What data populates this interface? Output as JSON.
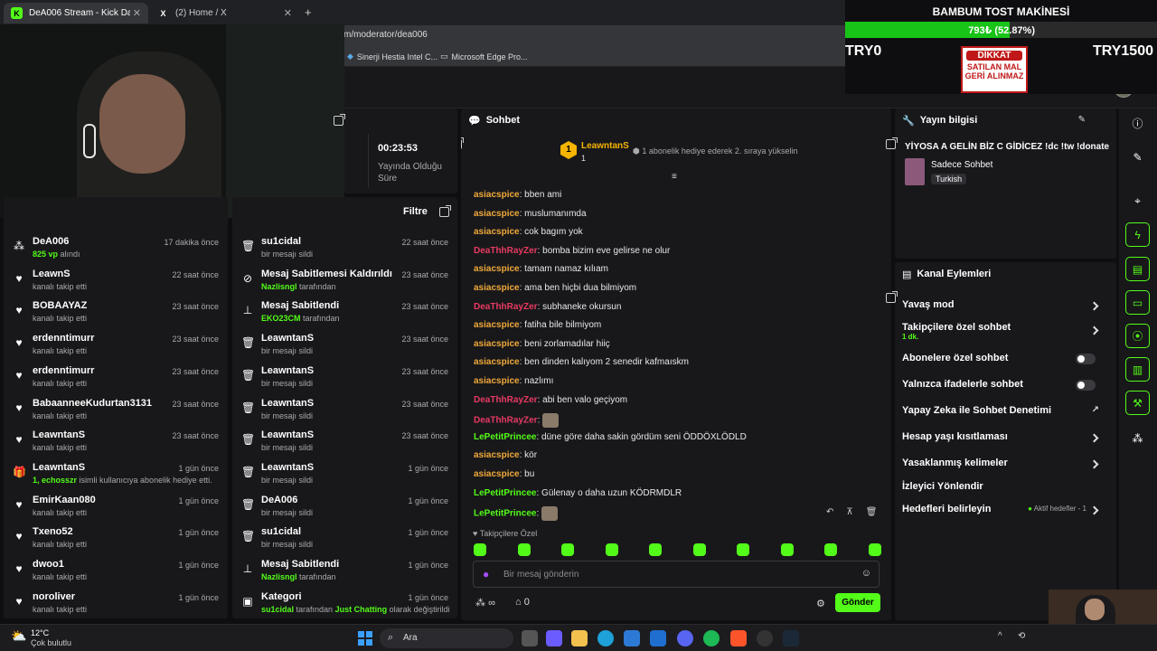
{
  "browser": {
    "tabs": [
      {
        "title": "DeA006 Stream - Kick Dashboard",
        "fav": "K"
      },
      {
        "title": "(2) Home / X",
        "fav": "X"
      }
    ],
    "url": "m/moderator/dea006",
    "bookmarks": [
      "Sinerji Hestia Intel C...",
      "Microsoft Edge Pro..."
    ],
    "new_tab": "+"
  },
  "overlay": {
    "goal_title": "BAMBUM TOST MAKİNESİ",
    "goal_amount": "793₺ (52.87%)",
    "goal_progress": 0.5287,
    "goal_start": "TRY0",
    "goal_end": "TRY1500",
    "sign_top": "DİKKAT",
    "sign_line1": "SATILAN MAL",
    "sign_line2": "GERİ ALINMAZ"
  },
  "stats": {
    "time_value": "00:23:53",
    "time_label_line1": "Yayında Olduğu",
    "time_label_line2": "Süre"
  },
  "activity_left": [
    {
      "icon": "vp-icon",
      "name": "DeA006",
      "sub_hl": "825 vp",
      "sub": " alındı",
      "time": "17 dakika önce"
    },
    {
      "icon": "heart-icon",
      "name": "LeawnS",
      "sub": "kanalı takip etti",
      "time": "22 saat önce"
    },
    {
      "icon": "heart-icon",
      "name": "BOBAAYAZ",
      "sub": "kanalı takip etti",
      "time": "23 saat önce"
    },
    {
      "icon": "heart-icon",
      "name": "erdenntimurr",
      "sub": "kanalı takip etti",
      "time": "23 saat önce"
    },
    {
      "icon": "heart-icon",
      "name": "erdenntimurr",
      "sub": "kanalı takip etti",
      "time": "23 saat önce"
    },
    {
      "icon": "heart-icon",
      "name": "BabaanneeKudurtan3131",
      "sub": "kanalı takip etti",
      "time": "23 saat önce"
    },
    {
      "icon": "heart-icon",
      "name": "LeawntanS",
      "sub": "kanalı takip etti",
      "time": "23 saat önce"
    },
    {
      "icon": "gift-icon",
      "name": "LeawntanS",
      "sub_hl": "1, echosszr",
      "sub": " isimli kullanıcıya abonelik hediye etti.",
      "time": "1 gün önce"
    },
    {
      "icon": "heart-icon",
      "name": "EmirKaan080",
      "sub": "kanalı takip etti",
      "time": "1 gün önce"
    },
    {
      "icon": "heart-icon",
      "name": "Txeno52",
      "sub": "kanalı takip etti",
      "time": "1 gün önce"
    },
    {
      "icon": "heart-icon",
      "name": "dwoo1",
      "sub": "kanalı takip etti",
      "time": "1 gün önce"
    },
    {
      "icon": "heart-icon",
      "name": "noroliver",
      "sub": "kanalı takip etti",
      "time": "1 gün önce"
    }
  ],
  "mod_panel": {
    "filter_label": "Filtre"
  },
  "activity_mid": [
    {
      "icon": "trash-icon",
      "name": "su1cidal",
      "sub": "bir mesajı sildi",
      "time": "22 saat önce"
    },
    {
      "icon": "unpin-icon",
      "name": "Mesaj Sabitlemesi Kaldırıldı",
      "sub_hl": "Nazlisngl",
      "sub": " tarafından",
      "time": "23 saat önce"
    },
    {
      "icon": "pin-icon",
      "name": "Mesaj Sabitlendi",
      "sub_hl": "EKO23CM",
      "sub": " tarafından",
      "time": "23 saat önce"
    },
    {
      "icon": "trash-icon",
      "name": "LeawntanS",
      "sub": "bir mesajı sildi",
      "time": "23 saat önce"
    },
    {
      "icon": "trash-icon",
      "name": "LeawntanS",
      "sub": "bir mesajı sildi",
      "time": "23 saat önce"
    },
    {
      "icon": "trash-icon",
      "name": "LeawntanS",
      "sub": "bir mesajı sildi",
      "time": "23 saat önce"
    },
    {
      "icon": "trash-icon",
      "name": "LeawntanS",
      "sub": "bir mesajı sildi",
      "time": "23 saat önce"
    },
    {
      "icon": "trash-icon",
      "name": "LeawntanS",
      "sub": "bir mesajı sildi",
      "time": "1 gün önce"
    },
    {
      "icon": "trash-icon",
      "name": "DeA006",
      "sub": "bir mesajı sildi",
      "time": "1 gün önce"
    },
    {
      "icon": "trash-icon",
      "name": "su1cidal",
      "sub": "bir mesajı sildi",
      "time": "1 gün önce"
    },
    {
      "icon": "pin-icon",
      "name": "Mesaj Sabitlendi",
      "sub_hl": "Nazlisngl",
      "sub": " tarafından",
      "time": "1 gün önce"
    },
    {
      "icon": "category-icon",
      "name": "Kategori",
      "sub_hl": "su1cidal",
      "sub": " tarafından ",
      "sub_hl2": "Just Chatting",
      "sub2": " olarak değiştirildi",
      "time": "1 gün önce"
    }
  ],
  "chat": {
    "title": "Sohbet",
    "top_user": "LeawntanS",
    "top_rank": "1",
    "top_count": "1",
    "gift_hint": "1 abonelik hediye ederek 2. sıraya yükselin",
    "messages": [
      {
        "user": "asiacspice",
        "color": "#f0a93a",
        "text": "bben ami"
      },
      {
        "user": "asiacspice",
        "color": "#f0a93a",
        "text": "muslumanımda"
      },
      {
        "user": "asiacspice",
        "color": "#f0a93a",
        "text": "cok bagım yok"
      },
      {
        "user": "DeaThhRayZer",
        "color": "#e83a63",
        "text": "bomba bizim eve gelirse ne olur"
      },
      {
        "user": "asiacspice",
        "color": "#f0a93a",
        "text": "tamam namaz kılıam"
      },
      {
        "user": "asiacspice",
        "color": "#f0a93a",
        "text": "ama ben hiçbi dua bilmiyom"
      },
      {
        "user": "DeaThhRayZer",
        "color": "#e83a63",
        "text": "subhaneke okursun"
      },
      {
        "user": "asiacspice",
        "color": "#f0a93a",
        "text": "fatiha bile bilmiyom"
      },
      {
        "user": "asiacspice",
        "color": "#f0a93a",
        "text": "beni zorlamadılar hiiç"
      },
      {
        "user": "asiacspice",
        "color": "#f0a93a",
        "text": "ben dinden kalıyom 2 senedir kafmaıskm"
      },
      {
        "user": "asiacspice",
        "color": "#f0a93a",
        "text": "nazlımı"
      },
      {
        "user": "DeaThhRayZer",
        "color": "#e83a63",
        "text": "abi ben valo geçiyom"
      },
      {
        "user": "DeaThhRayZer",
        "color": "#e83a63",
        "text": "",
        "emote": true
      },
      {
        "user": "LePetitPrincee",
        "color": "#53fc18",
        "text": "düne göre daha sakin gördüm seni ÖDDÖXLÖDLD"
      },
      {
        "user": "asiacspice",
        "color": "#f0a93a",
        "text": "kör"
      },
      {
        "user": "asiacspice",
        "color": "#f0a93a",
        "text": "bu"
      },
      {
        "user": "LePetitPrincee",
        "color": "#53fc18",
        "text": "Gülenay o daha uzun KÖDRMDLR"
      },
      {
        "user": "LePetitPrincee",
        "color": "#53fc18",
        "text": "",
        "emote": true
      }
    ],
    "followers_only": "Takipçilere Özel",
    "input_placeholder": "Bir mesaj gönderin",
    "infinity": "∞",
    "store_count": "0",
    "send_label": "Gönder"
  },
  "stream_info": {
    "title": "Yayın bilgisi",
    "stream_title": "YİYOSA A GELİN BİZ C GİDİCEZ !dc !tw !donate",
    "category": "Sadece Sohbet",
    "language": "Turkish"
  },
  "channel_actions": {
    "title": "Kanal Eylemleri",
    "items": [
      {
        "label": "Yavaş mod",
        "type": "chevron"
      },
      {
        "label": "Takipçilere özel sohbet",
        "sub": "1 dk.",
        "type": "chevron"
      },
      {
        "label": "Abonelere özel sohbet",
        "type": "toggle"
      },
      {
        "label": "Yalnızca ifadelerle sohbet",
        "type": "toggle"
      },
      {
        "label": "Yapay Zeka ile Sohbet Denetimi",
        "type": "external"
      },
      {
        "label": "Hesap yaşı kısıtlaması",
        "type": "chevron"
      },
      {
        "label": "Yasaklanmış kelimeler",
        "type": "chevron"
      },
      {
        "label": "İzleyici Yönlendir",
        "type": "none"
      },
      {
        "label": "Hedefleri belirleyin",
        "type": "chevron",
        "badge": "Aktif hedefler - 1"
      }
    ]
  },
  "taskbar": {
    "temp": "12°C",
    "weather": "Çok bulutlu",
    "search": "Ara"
  },
  "colors": {
    "accent": "#53fc18",
    "panel": "#18181b",
    "bg": "#0e0e10"
  }
}
